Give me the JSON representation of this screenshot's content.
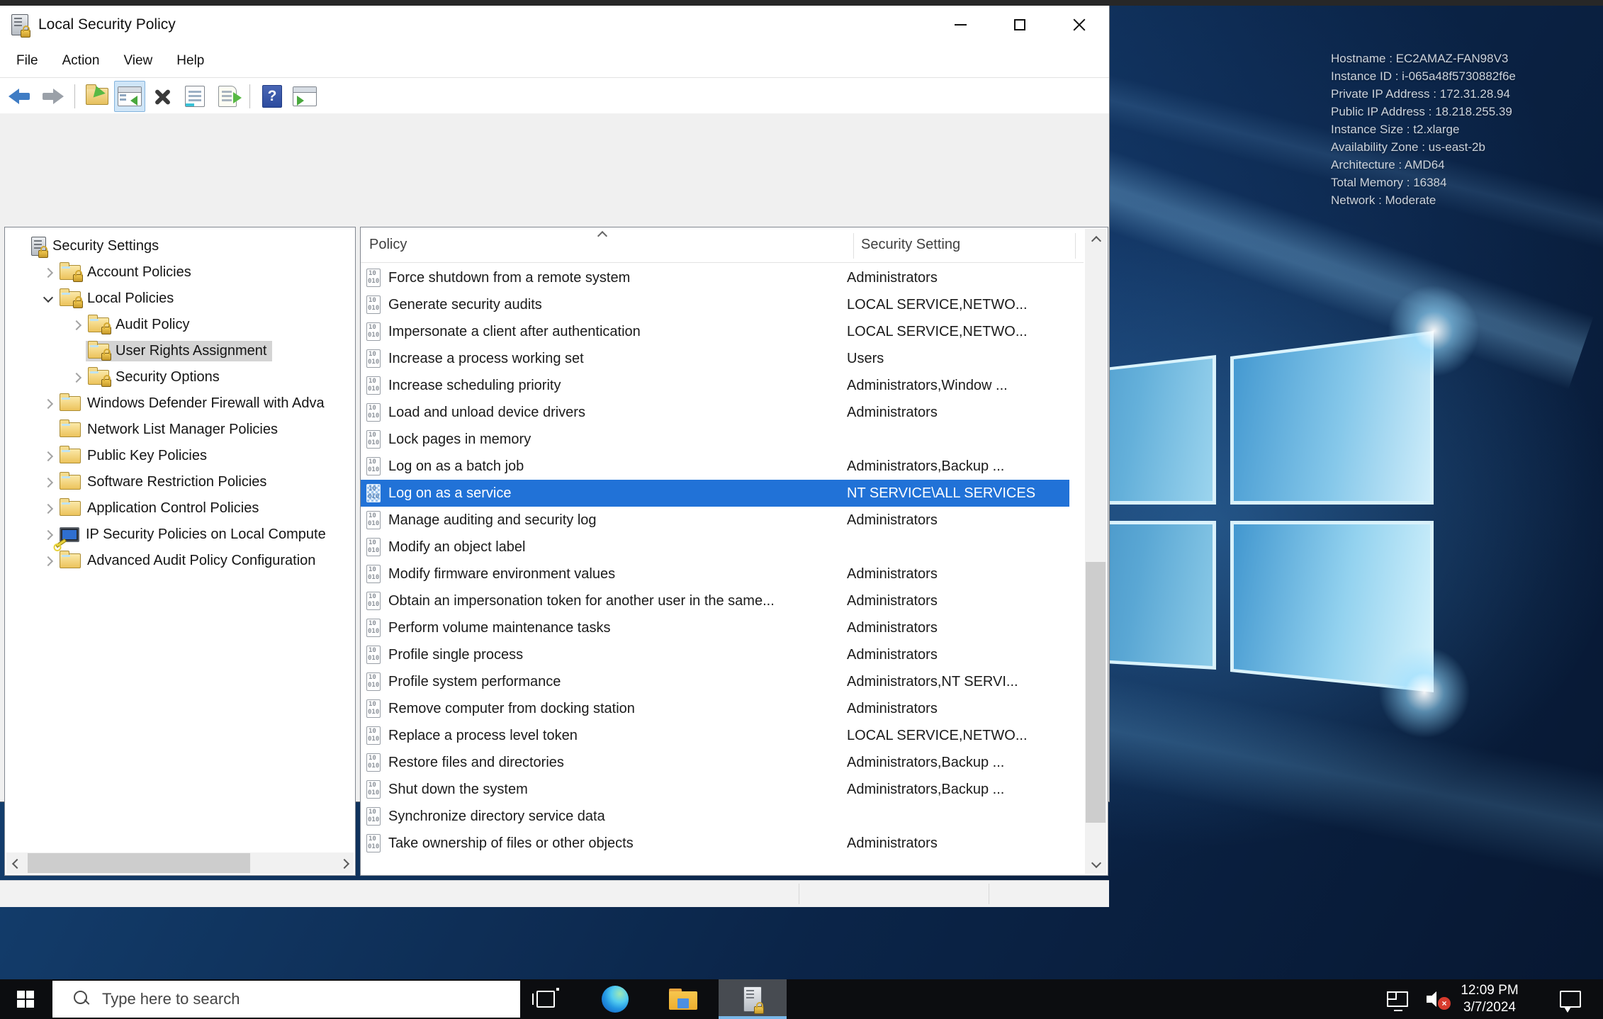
{
  "window": {
    "title": "Local Security Policy",
    "menu_items": [
      "File",
      "Action",
      "View",
      "Help"
    ],
    "toolbar_icons": [
      "back-icon",
      "forward-icon",
      "export-icon",
      "show-console-tree-icon",
      "delete-icon",
      "properties-icon",
      "export-list-icon",
      "help-icon",
      "show-action-pane-icon"
    ],
    "tree": {
      "items": [
        {
          "label": "Security Settings",
          "level": 0,
          "icon": "security-root-icon",
          "expander": "none",
          "selected": false
        },
        {
          "label": "Account Policies",
          "level": 1,
          "icon": "folder-lock-icon",
          "expander": "collapsed",
          "selected": false
        },
        {
          "label": "Local Policies",
          "level": 1,
          "icon": "folder-lock-icon",
          "expander": "expanded",
          "selected": false
        },
        {
          "label": "Audit Policy",
          "level": 2,
          "icon": "folder-lock-icon",
          "expander": "collapsed",
          "selected": false
        },
        {
          "label": "User Rights Assignment",
          "level": 2,
          "icon": "folder-lock-icon",
          "expander": "none",
          "selected": true
        },
        {
          "label": "Security Options",
          "level": 2,
          "icon": "folder-lock-icon",
          "expander": "collapsed",
          "selected": false
        },
        {
          "label": "Windows Defender Firewall with Adva",
          "level": 1,
          "icon": "folder-icon",
          "expander": "collapsed",
          "selected": false
        },
        {
          "label": "Network List Manager Policies",
          "level": 1,
          "icon": "folder-icon",
          "expander": "none",
          "selected": false
        },
        {
          "label": "Public Key Policies",
          "level": 1,
          "icon": "folder-icon",
          "expander": "collapsed",
          "selected": false
        },
        {
          "label": "Software Restriction Policies",
          "level": 1,
          "icon": "folder-icon",
          "expander": "collapsed",
          "selected": false
        },
        {
          "label": "Application Control Policies",
          "level": 1,
          "icon": "folder-icon",
          "expander": "collapsed",
          "selected": false
        },
        {
          "label": "IP Security Policies on Local Compute",
          "level": 1,
          "icon": "computer-key-icon",
          "expander": "collapsed",
          "selected": false
        },
        {
          "label": "Advanced Audit Policy Configuration",
          "level": 1,
          "icon": "folder-icon",
          "expander": "collapsed",
          "selected": false
        }
      ]
    },
    "list": {
      "columns": [
        "Policy",
        "Security Setting"
      ],
      "sorted_column": "Policy",
      "rows": [
        {
          "policy": "Force shutdown from a remote system",
          "setting": "Administrators",
          "selected": false
        },
        {
          "policy": "Generate security audits",
          "setting": "LOCAL SERVICE,NETWO...",
          "selected": false
        },
        {
          "policy": "Impersonate a client after authentication",
          "setting": "LOCAL SERVICE,NETWO...",
          "selected": false
        },
        {
          "policy": "Increase a process working set",
          "setting": "Users",
          "selected": false
        },
        {
          "policy": "Increase scheduling priority",
          "setting": "Administrators,Window ...",
          "selected": false
        },
        {
          "policy": "Load and unload device drivers",
          "setting": "Administrators",
          "selected": false
        },
        {
          "policy": "Lock pages in memory",
          "setting": "",
          "selected": false
        },
        {
          "policy": "Log on as a batch job",
          "setting": "Administrators,Backup ...",
          "selected": false
        },
        {
          "policy": "Log on as a service",
          "setting": "NT SERVICE\\ALL SERVICES",
          "selected": true
        },
        {
          "policy": "Manage auditing and security log",
          "setting": "Administrators",
          "selected": false
        },
        {
          "policy": "Modify an object label",
          "setting": "",
          "selected": false
        },
        {
          "policy": "Modify firmware environment values",
          "setting": "Administrators",
          "selected": false
        },
        {
          "policy": "Obtain an impersonation token for another user in the same...",
          "setting": "Administrators",
          "selected": false
        },
        {
          "policy": "Perform volume maintenance tasks",
          "setting": "Administrators",
          "selected": false
        },
        {
          "policy": "Profile single process",
          "setting": "Administrators",
          "selected": false
        },
        {
          "policy": "Profile system performance",
          "setting": "Administrators,NT SERVI...",
          "selected": false
        },
        {
          "policy": "Remove computer from docking station",
          "setting": "Administrators",
          "selected": false
        },
        {
          "policy": "Replace a process level token",
          "setting": "LOCAL SERVICE,NETWO...",
          "selected": false
        },
        {
          "policy": "Restore files and directories",
          "setting": "Administrators,Backup ...",
          "selected": false
        },
        {
          "policy": "Shut down the system",
          "setting": "Administrators,Backup ...",
          "selected": false
        },
        {
          "policy": "Synchronize directory service data",
          "setting": "",
          "selected": false
        },
        {
          "policy": "Take ownership of files or other objects",
          "setting": "Administrators",
          "selected": false
        }
      ]
    }
  },
  "desktop": {
    "info_lines": [
      "Hostname : EC2AMAZ-FAN98V3",
      "Instance ID : i-065a48f5730882f6e",
      "Private IP Address : 172.31.28.94",
      "Public IP Address : 18.218.255.39",
      "Instance Size : t2.xlarge",
      "Availability Zone : us-east-2b",
      "Architecture : AMD64",
      "Total Memory : 16384",
      "Network : Moderate"
    ]
  },
  "taskbar": {
    "search_placeholder": "Type here to search",
    "clock_time": "12:09 PM",
    "clock_date": "3/7/2024",
    "icons": [
      "start-icon",
      "search-icon",
      "task-view-icon",
      "edge-icon",
      "file-explorer-icon",
      "local-security-policy-icon",
      "network-icon",
      "volume-muted-icon",
      "action-center-icon"
    ]
  },
  "colors": {
    "selection_blue": "#2172d7",
    "tree_selection_gray": "#d4d4d4",
    "taskbar_black": "#0c0d10",
    "active_task_underline": "#79b7e8",
    "desktop_base": "#0b2549"
  }
}
